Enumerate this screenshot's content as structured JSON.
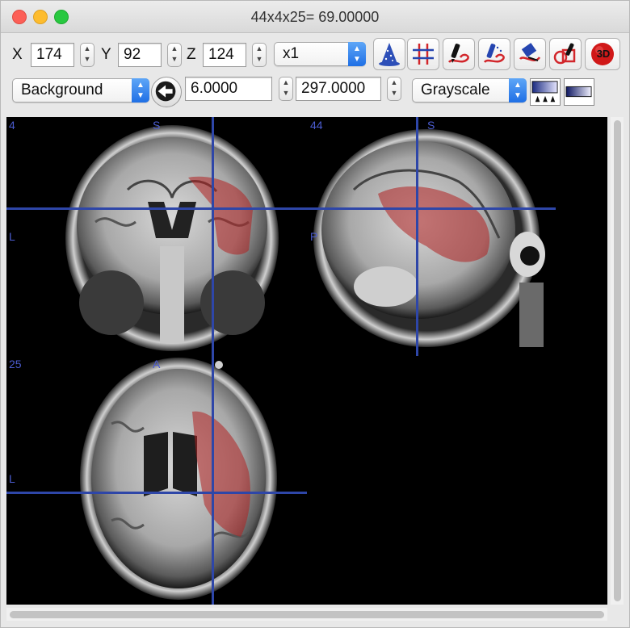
{
  "window": {
    "title": "44x4x25= 69.00000"
  },
  "coords": {
    "x_label": "X",
    "x_value": "174",
    "y_label": "Y",
    "y_value": "92",
    "z_label": "Z",
    "z_value": "124",
    "zoom": "x1"
  },
  "toolbar_icons": [
    "wizard-hat-icon",
    "grid-icon",
    "pen-draw-icon",
    "pen-erase-icon",
    "fill-bucket-icon",
    "overlay-pen-icon",
    "3d-render-icon"
  ],
  "toolbar_3d_label": "3D",
  "display": {
    "layer": "Background",
    "min": "6.0000",
    "max": "297.0000",
    "colormap": "Grayscale"
  },
  "views": {
    "coronal": {
      "slice": "4",
      "top": "S",
      "left": "L"
    },
    "sagittal": {
      "slice": "44",
      "top": "S",
      "left": "P"
    },
    "axial": {
      "slice": "25",
      "top": "A",
      "left": "L"
    }
  },
  "colors": {
    "crosshair": "#2e46a8",
    "overlay": "#b02020",
    "label": "#4b5cd0"
  }
}
